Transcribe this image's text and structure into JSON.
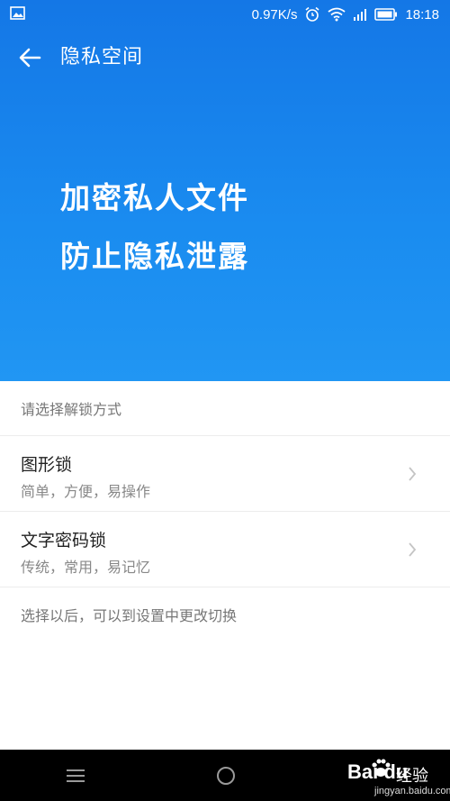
{
  "status_bar": {
    "network_speed": "0.97K/s",
    "time": "18:18",
    "icons": [
      "image-icon",
      "alarm-icon",
      "wifi-icon",
      "signal-icon",
      "battery-icon"
    ]
  },
  "app_bar": {
    "title": "隐私空间",
    "back_icon": "arrow-left-icon"
  },
  "hero": {
    "line1": "加密私人文件",
    "line2": "防止隐私泄露"
  },
  "unlock": {
    "header": "请选择解锁方式",
    "options": [
      {
        "title": "图形锁",
        "subtitle": "简单，方便，易操作"
      },
      {
        "title": "文字密码锁",
        "subtitle": "传统，常用，易记忆"
      }
    ],
    "footnote": "选择以后，可以到设置中更改切换"
  },
  "nav_bar": {
    "icons": [
      "menu-icon",
      "home-icon"
    ]
  },
  "watermark": {
    "brand": "Bai du",
    "text": "经验",
    "url": "jingyan.baidu.com"
  },
  "colors": {
    "primary": "#1a8cf0",
    "divider": "#ececec",
    "nav_bar": "#000000"
  }
}
